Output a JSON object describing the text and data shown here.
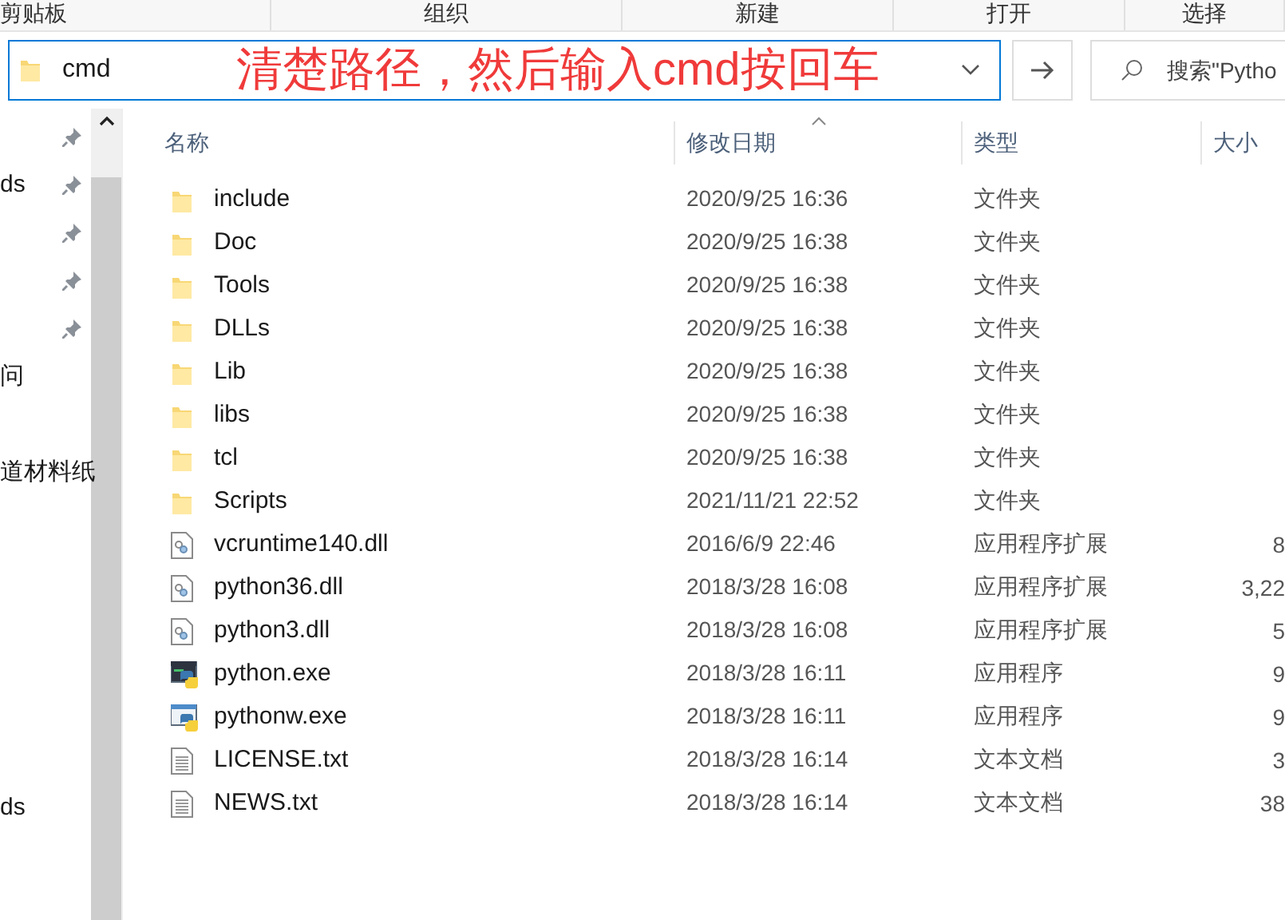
{
  "ribbon_groups": [
    "剪贴板",
    "组织",
    "新建",
    "打开",
    "选择"
  ],
  "address_bar": {
    "value": "cmd"
  },
  "annotation": "清楚路径，然后输入cmd按回车",
  "search": {
    "placeholder": "搜索\"Pytho"
  },
  "nav_items": [
    {
      "pinned": true
    },
    {
      "label": "ds",
      "pinned": true
    },
    {
      "pinned": true
    },
    {
      "pinned": true
    },
    {
      "pinned": true
    },
    {
      "label": "问",
      "pinned": false
    },
    {
      "pinned": false
    },
    {
      "label": "道材料纸",
      "pinned": false
    },
    {
      "pinned": false
    },
    {
      "pinned": false
    },
    {
      "pinned": false
    },
    {
      "pinned": false
    },
    {
      "pinned": false
    },
    {
      "pinned": false
    },
    {
      "label": "ds",
      "pinned": false
    }
  ],
  "columns": [
    {
      "label": "名称",
      "sorted": false
    },
    {
      "label": "修改日期",
      "sorted": true
    },
    {
      "label": "类型",
      "sorted": false
    },
    {
      "label": "大小",
      "sorted": false
    }
  ],
  "files": [
    {
      "kind": "folder",
      "name": "include",
      "date": "2020/9/25 16:36",
      "type": "文件夹"
    },
    {
      "kind": "folder",
      "name": "Doc",
      "date": "2020/9/25 16:38",
      "type": "文件夹"
    },
    {
      "kind": "folder",
      "name": "Tools",
      "date": "2020/9/25 16:38",
      "type": "文件夹"
    },
    {
      "kind": "folder",
      "name": "DLLs",
      "date": "2020/9/25 16:38",
      "type": "文件夹"
    },
    {
      "kind": "folder",
      "name": "Lib",
      "date": "2020/9/25 16:38",
      "type": "文件夹"
    },
    {
      "kind": "folder",
      "name": "libs",
      "date": "2020/9/25 16:38",
      "type": "文件夹"
    },
    {
      "kind": "folder",
      "name": "tcl",
      "date": "2020/9/25 16:38",
      "type": "文件夹"
    },
    {
      "kind": "folder",
      "name": "Scripts",
      "date": "2021/11/21 22:52",
      "type": "文件夹"
    },
    {
      "kind": "dll",
      "name": "vcruntime140.dll",
      "date": "2016/6/9 22:46",
      "type": "应用程序扩展",
      "size": "8"
    },
    {
      "kind": "dll",
      "name": "python36.dll",
      "date": "2018/3/28 16:08",
      "type": "应用程序扩展",
      "size": "3,22"
    },
    {
      "kind": "dll",
      "name": "python3.dll",
      "date": "2018/3/28 16:08",
      "type": "应用程序扩展",
      "size": "5"
    },
    {
      "kind": "console_exe",
      "name": "python.exe",
      "date": "2018/3/28 16:11",
      "type": "应用程序",
      "size": "9"
    },
    {
      "kind": "window_exe",
      "name": "pythonw.exe",
      "date": "2018/3/28 16:11",
      "type": "应用程序",
      "size": "9"
    },
    {
      "kind": "text",
      "name": "LICENSE.txt",
      "date": "2018/3/28 16:14",
      "type": "文本文档",
      "size": "3"
    },
    {
      "kind": "text",
      "name": "NEWS.txt",
      "date": "2018/3/28 16:14",
      "type": "文本文档",
      "size": "38"
    }
  ]
}
